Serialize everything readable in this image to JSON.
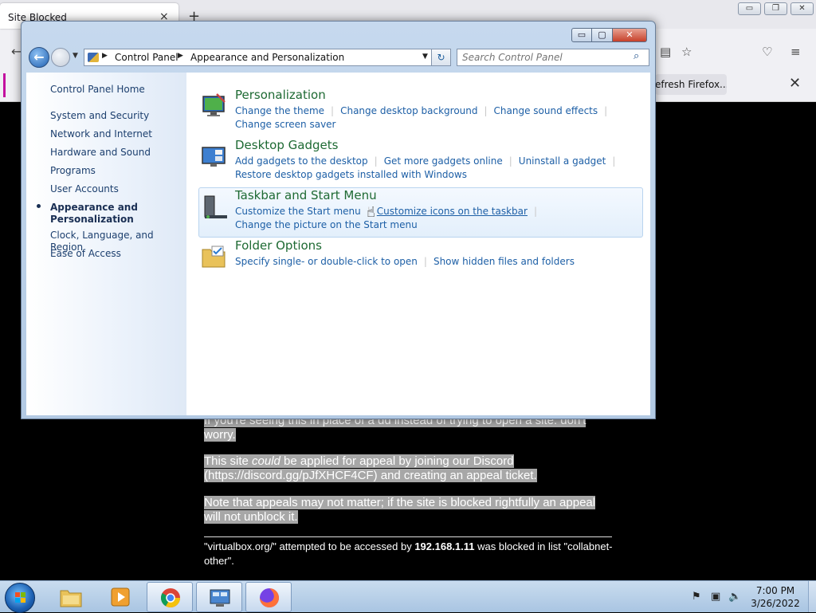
{
  "browser": {
    "tab_title": "Site Blocked",
    "tab_close": "×",
    "new_tab": "+",
    "back": "←",
    "notice_text": "efresh Firefox...",
    "notice_close": "✕",
    "win_min": "▭",
    "win_max": "❐",
    "win_close": "✕"
  },
  "blocked_page": {
    "para1": "If you're seeing this in place of a dd instead of trying to open a site: don't worry.",
    "para2_a": "This site ",
    "para2_em": "could",
    "para2_b": " be applied for appeal by joining our Discord (https://discord.gg/pJfXHCF4CF) and creating an appeal ticket.",
    "para3": "Note that appeals may not matter; if the site is blocked rightfully an appeal will not unblock it.",
    "footer_a": "\"virtualbox.org/\" attempted to be accessed by ",
    "footer_ip": "192.168.1.11",
    "footer_b": " was blocked in list \"collabnet-other\"."
  },
  "control_panel": {
    "caption": {
      "min": "▭",
      "max": "▢",
      "close": "✕"
    },
    "nav": {
      "back": "←"
    },
    "breadcrumb": [
      "Control Panel",
      "Appearance and Personalization"
    ],
    "search_placeholder": "Search Control Panel",
    "sidebar": {
      "home": "Control Panel Home",
      "items": [
        "System and Security",
        "Network and Internet",
        "Hardware and Sound",
        "Programs",
        "User Accounts",
        "Appearance and Personalization",
        "Clock, Language, and Region",
        "Ease of Access"
      ],
      "current_index": 5
    },
    "categories": [
      {
        "title": "Personalization",
        "icon": "personalization-icon",
        "links": [
          "Change the theme",
          "Change desktop background",
          "Change sound effects",
          "Change screen saver"
        ]
      },
      {
        "title": "Desktop Gadgets",
        "icon": "gadgets-icon",
        "links": [
          "Add gadgets to the desktop",
          "Get more gadgets online",
          "Uninstall a gadget",
          "Restore desktop gadgets installed with Windows"
        ]
      },
      {
        "title": "Taskbar and Start Menu",
        "icon": "taskbar-icon",
        "links": [
          "Customize the Start menu",
          "Customize icons on the taskbar",
          "Change the picture on the Start menu"
        ]
      },
      {
        "title": "Folder Options",
        "icon": "folder-options-icon",
        "links": [
          "Specify single- or double-click to open",
          "Show hidden files and folders"
        ]
      }
    ]
  },
  "taskbar": {
    "pinned": [
      "windows-explorer-icon",
      "media-player-icon",
      "chrome-icon",
      "control-panel-icon",
      "firefox-icon"
    ],
    "clock_time": "7:00 PM",
    "clock_date": "3/26/2022"
  },
  "colors": {
    "category_title": "#1e6a33",
    "link": "#1d5fa6",
    "taskbar": "#a9c5e2"
  }
}
